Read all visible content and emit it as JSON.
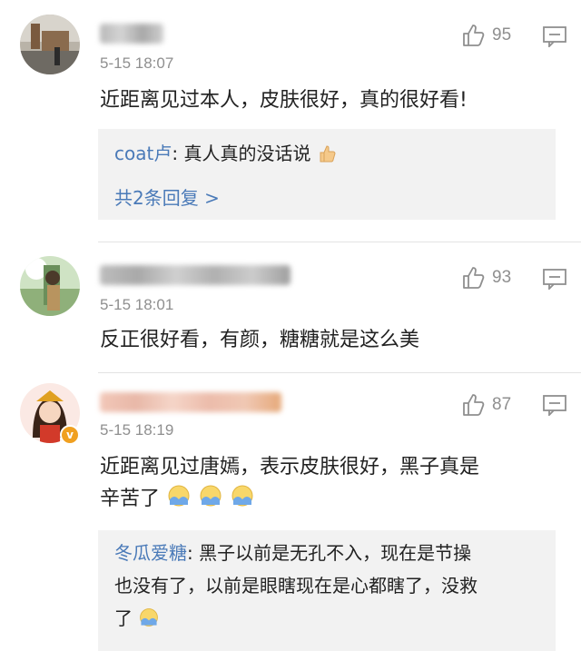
{
  "comments": [
    {
      "username": "",
      "time": "5-15 18:07",
      "likes": "95",
      "text": "近距离见过本人，皮肤很好，真的很好看!",
      "replies": {
        "user": "coat卢",
        "sep": ": ",
        "text": "真人真的没话说",
        "emoji": "thumbs-up",
        "more": "共2条回复 >"
      }
    },
    {
      "username": "",
      "time": "5-15 18:01",
      "likes": "93",
      "text": "反正很好看，有颜，糖糖就是这么美"
    },
    {
      "username": "",
      "time": "5-15 18:19",
      "likes": "87",
      "verified": true,
      "text_line1": "近距离见过唐嫣，表示皮肤很好，黑子真是",
      "text_line2": "辛苦了",
      "replies": {
        "user": "冬瓜爱糖",
        "sep": ": ",
        "line1": "黑子以前是无孔不入，现在是节操",
        "line2": "也没有了，以前是眼瞎现在是心都瞎了，没救",
        "line3": "了"
      }
    }
  ],
  "colors": {
    "link": "#4a7ab8",
    "meta": "#8f8f8f",
    "reply_bg": "#f2f2f2"
  }
}
